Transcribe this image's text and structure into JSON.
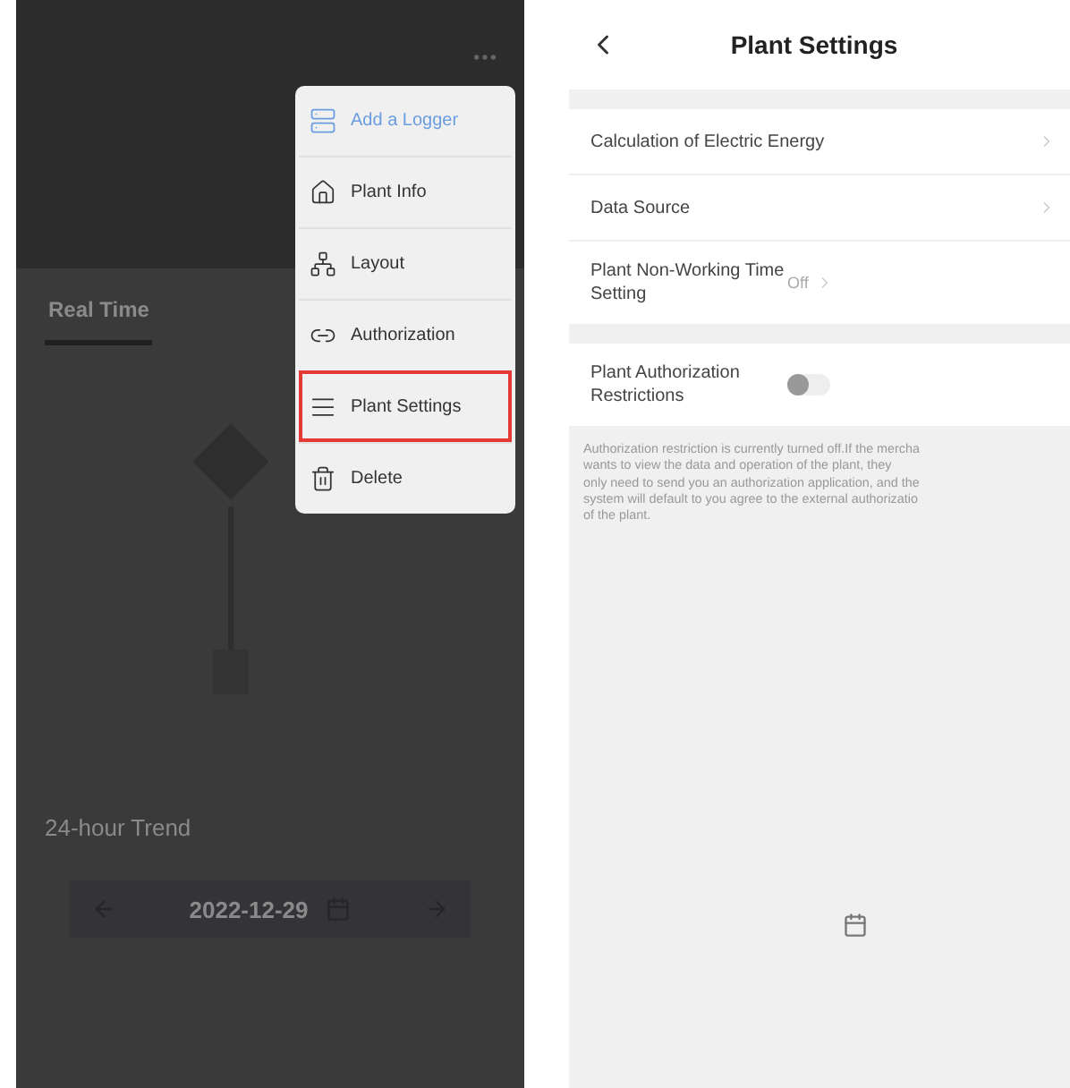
{
  "left_screen": {
    "tabs": [
      {
        "label": "Real Time",
        "selected": true
      }
    ],
    "trend": {
      "title": "24-hour Trend",
      "date": "2022-12-29"
    },
    "menu": {
      "items": [
        {
          "label": "Add a Logger",
          "kind": "accent",
          "selected": false
        },
        {
          "label": "Plant Info",
          "kind": "info",
          "selected": false
        },
        {
          "label": "Layout",
          "kind": "layout",
          "selected": false
        },
        {
          "label": "Authorization",
          "kind": "link",
          "selected": false
        },
        {
          "label": "Plant Settings",
          "kind": "settings",
          "selected": true
        },
        {
          "label": "Delete",
          "kind": "delete",
          "selected": false
        }
      ]
    }
  },
  "right_screen": {
    "title": "Plant Settings",
    "groups": [
      [
        {
          "kind": "link",
          "label": "Calculation of Electric Energy"
        },
        {
          "kind": "link",
          "label": "Data Source"
        },
        {
          "kind": "link",
          "label": "Plant Non-Working Time Setting",
          "value": "Off"
        }
      ],
      [
        {
          "kind": "toggle",
          "label": "Plant Authorization Restrictions",
          "on": false
        }
      ]
    ],
    "note_lines": [
      "Authorization restriction is currently turned off.If the mercha",
      "wants to view the data and operation of the plant, they",
      "only need to send you an authorization application, and the",
      "system will default to you agree to the external authorizatio",
      "of the plant."
    ]
  }
}
